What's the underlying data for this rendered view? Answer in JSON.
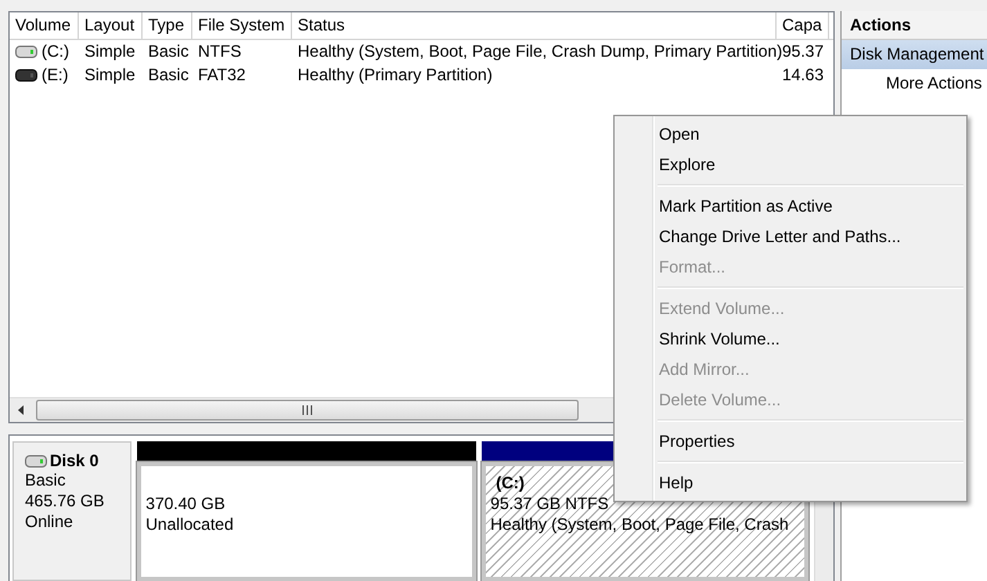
{
  "volume_list": {
    "columns": [
      "Volume",
      "Layout",
      "Type",
      "File System",
      "Status",
      "Capa"
    ],
    "rows": [
      {
        "kind": "system",
        "selected": false,
        "cells": [
          "(C:)",
          "Simple",
          "Basic",
          "NTFS",
          "Healthy (System, Boot, Page File, Crash Dump, Primary Partition)",
          "95.37"
        ]
      },
      {
        "kind": "removable",
        "selected": false,
        "cells": [
          "(E:)",
          "Simple",
          "Basic",
          "FAT32",
          "Healthy (Primary Partition)",
          "14.63"
        ]
      }
    ]
  },
  "disk": {
    "name": "Disk 0",
    "type": "Basic",
    "size": "465.76 GB",
    "status": "Online",
    "partitions": [
      {
        "kind": "unallocated",
        "lines": [
          "370.40 GB",
          "Unallocated"
        ]
      },
      {
        "kind": "primary",
        "title": "(C:)",
        "lines": [
          "95.37 GB NTFS",
          "Healthy (System, Boot, Page File, Crash"
        ]
      }
    ]
  },
  "actions": {
    "title": "Actions",
    "items": [
      {
        "label": "Disk Management",
        "selected": true,
        "kind": "section"
      },
      {
        "label": "More Actions",
        "selected": false,
        "kind": "sub"
      }
    ]
  },
  "context_menu": [
    [
      {
        "label": "Open",
        "disabled": false
      },
      {
        "label": "Explore",
        "disabled": false
      }
    ],
    [
      {
        "label": "Mark Partition as Active",
        "disabled": false
      },
      {
        "label": "Change Drive Letter and Paths...",
        "disabled": false
      },
      {
        "label": "Format...",
        "disabled": true
      }
    ],
    [
      {
        "label": "Extend Volume...",
        "disabled": true
      },
      {
        "label": "Shrink Volume...",
        "disabled": false
      },
      {
        "label": "Add Mirror...",
        "disabled": true
      },
      {
        "label": "Delete Volume...",
        "disabled": true
      }
    ],
    [
      {
        "label": "Properties",
        "disabled": false
      }
    ],
    [
      {
        "label": "Help",
        "disabled": false
      }
    ]
  ]
}
